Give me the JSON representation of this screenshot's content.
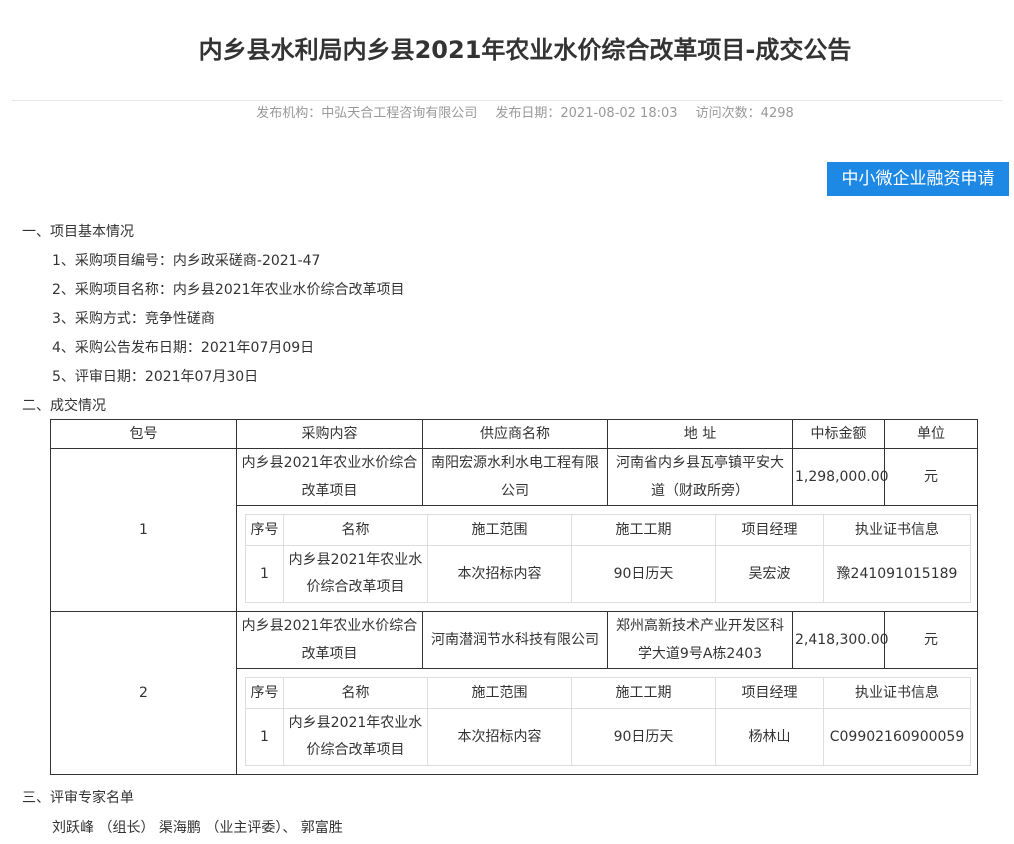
{
  "title": "内乡县水利局内乡县2021年农业水价综合改革项目-成交公告",
  "meta": {
    "publisher": "发布机构：中弘天合工程咨询有限公司",
    "date": "发布日期：2021-08-02 18:03",
    "visits": "访问次数：4298"
  },
  "finance_button": "中小微企业融资申请",
  "section1": {
    "heading": "一、项目基本情况",
    "items": [
      "1、采购项目编号：内乡政采磋商-2021-47",
      "2、采购项目名称：内乡县2021年农业水价综合改革项目",
      "3、采购方式：竞争性磋商",
      "4、采购公告发布日期：2021年07月09日",
      "5、评审日期：2021年07月30日"
    ]
  },
  "section2": {
    "heading": "二、成交情况",
    "headers": [
      "包号",
      "采购内容",
      "供应商名称",
      "地 址",
      "中标金额",
      "单位"
    ],
    "inner_headers": [
      "序号",
      "名称",
      "施工范围",
      "施工工期",
      "项目经理",
      "执业证书信息"
    ],
    "packages": [
      {
        "no": "1",
        "content": "内乡县2021年农业水价综合改革项目",
        "supplier": "南阳宏源水利水电工程有限公司",
        "address": "河南省内乡县瓦亭镇平安大道（财政所旁）",
        "amount": "1,298,000.00",
        "unit": "元",
        "detail": {
          "seq": "1",
          "name": "内乡县2021年农业水价综合改革项目",
          "scope": "本次招标内容",
          "period": "90日历天",
          "manager": "吴宏波",
          "cert": "豫241091015189"
        }
      },
      {
        "no": "2",
        "content": "内乡县2021年农业水价综合改革项目",
        "supplier": "河南潜润节水科技有限公司",
        "address": "郑州高新技术产业开发区科学大道9号A栋2403",
        "amount": "2,418,300.00",
        "unit": "元",
        "detail": {
          "seq": "1",
          "name": "内乡县2021年农业水价综合改革项目",
          "scope": "本次招标内容",
          "period": "90日历天",
          "manager": "杨林山",
          "cert": "C09902160900059"
        }
      }
    ]
  },
  "section3": {
    "heading": "三、评审专家名单",
    "experts": "刘跃峰 （组长） 渠海鹏 （业主评委）、 郭富胜"
  }
}
